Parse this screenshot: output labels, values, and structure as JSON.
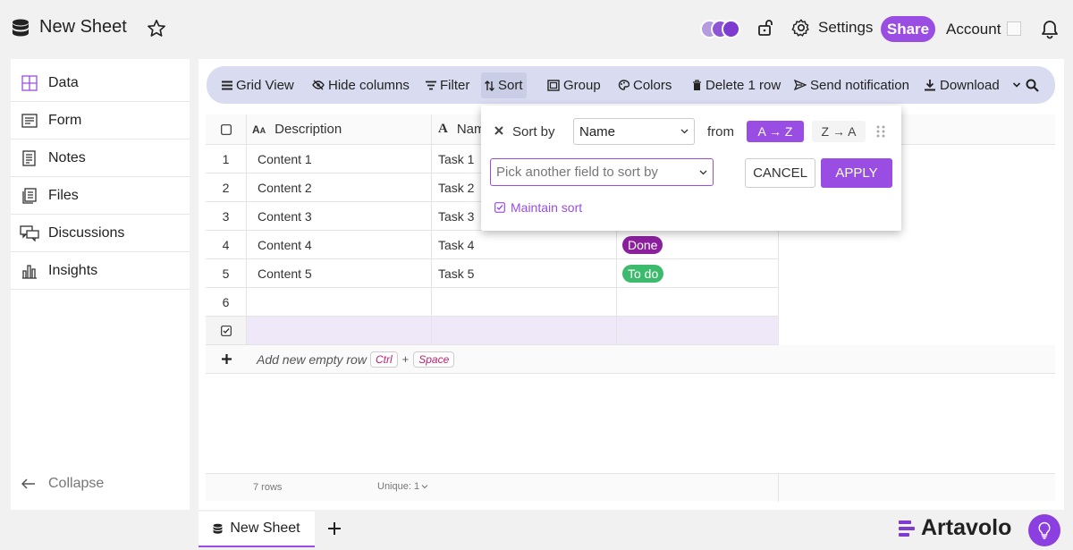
{
  "header": {
    "title": "New Sheet",
    "settings_label": "Settings",
    "share_label": "Share",
    "account_label": "Account"
  },
  "sidebar": {
    "items": [
      {
        "label": "Data",
        "icon": "grid-icon"
      },
      {
        "label": "Form",
        "icon": "form-icon"
      },
      {
        "label": "Notes",
        "icon": "notes-icon"
      },
      {
        "label": "Files",
        "icon": "files-icon"
      },
      {
        "label": "Discussions",
        "icon": "chat-icon"
      },
      {
        "label": "Insights",
        "icon": "chart-icon"
      }
    ],
    "collapse_label": "Collapse"
  },
  "toolbar": {
    "grid_view": "Grid View",
    "hide_columns": "Hide columns",
    "filter": "Filter",
    "sort": "Sort",
    "group": "Group",
    "colors": "Colors",
    "delete_row": "Delete 1 row",
    "send_notification": "Send notification",
    "download": "Download"
  },
  "grid": {
    "columns": [
      "Description",
      "Nam"
    ],
    "rows": [
      {
        "num": "1",
        "description": "Content 1",
        "name": "Task 1",
        "status": ""
      },
      {
        "num": "2",
        "description": "Content 2",
        "name": "Task 2",
        "status": ""
      },
      {
        "num": "3",
        "description": "Content 3",
        "name": "Task 3",
        "status": ""
      },
      {
        "num": "4",
        "description": "Content 4",
        "name": "Task 4",
        "status": "Done"
      },
      {
        "num": "5",
        "description": "Content 5",
        "name": "Task 5",
        "status": "To do"
      },
      {
        "num": "6",
        "description": "",
        "name": "",
        "status": ""
      }
    ],
    "status_colors": {
      "Done": "#8b1f9e",
      "To do": "#3dbb6c"
    },
    "add_row_label": "Add new empty row",
    "kbd_ctrl": "Ctrl",
    "kbd_plus": "+",
    "kbd_space": "Space",
    "rows_count": "7 rows",
    "unique_label": "Unique: 1"
  },
  "sort_popup": {
    "sort_by_label": "Sort by",
    "field_value": "Name",
    "from_label": "from",
    "asc_label": "A → Z",
    "desc_label": "Z → A",
    "pick_placeholder": "Pick another field to sort by",
    "cancel_label": "CANCEL",
    "apply_label": "APPLY",
    "maintain_label": "Maintain sort"
  },
  "tabs": {
    "active": "New Sheet",
    "add": "+"
  },
  "brand": {
    "name": "Artavolo",
    "accent": "#9a4de3"
  }
}
